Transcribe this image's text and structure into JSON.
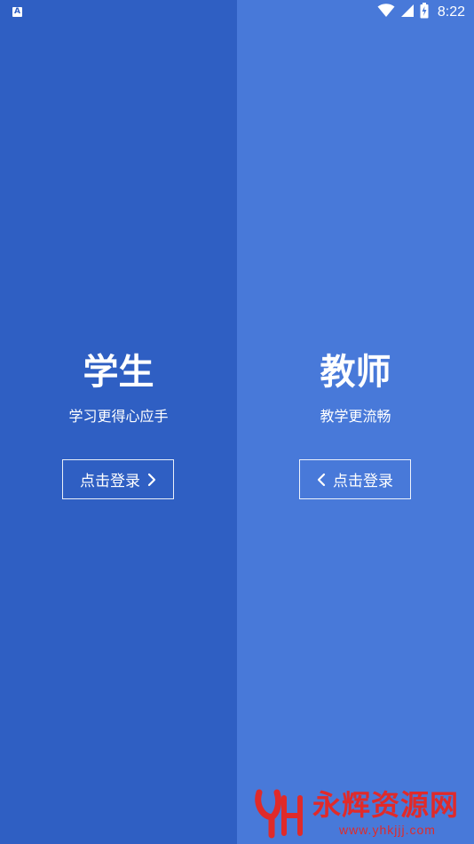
{
  "status_bar": {
    "time": "8:22",
    "app_icon_letter": "A",
    "icons": [
      "wifi-icon",
      "cellular-signal-icon",
      "battery-icon"
    ]
  },
  "student": {
    "title": "学生",
    "subtitle": "学习更得心应手",
    "login_label": "点击登录",
    "background": "#2f5fc3"
  },
  "teacher": {
    "title": "教师",
    "subtitle": "教学更流畅",
    "login_label": "点击登录",
    "background": "#4879d9"
  },
  "watermark": {
    "name": "永辉资源网",
    "url": "www.yhkjjj.com"
  }
}
